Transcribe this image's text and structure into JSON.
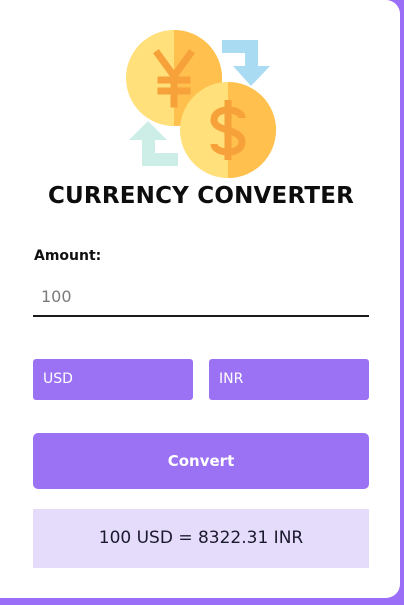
{
  "app": {
    "title": "CURRENCY CONVERTER",
    "logo_icon": "currency-exchange-icon"
  },
  "amount": {
    "label": "Amount:",
    "value": "100"
  },
  "currencies": {
    "from": "USD",
    "to": "INR"
  },
  "actions": {
    "convert_label": "Convert"
  },
  "result": {
    "text": "100 USD = 8322.31 INR"
  },
  "colors": {
    "accent": "#9b72f4",
    "page_background": "#9b6ef7",
    "result_background": "#e5dcfb",
    "coin_light": "#ffe07a",
    "coin_dark": "#ffc04d",
    "arrow_blue": "#a9dcf2",
    "arrow_green": "#cdeee6"
  }
}
